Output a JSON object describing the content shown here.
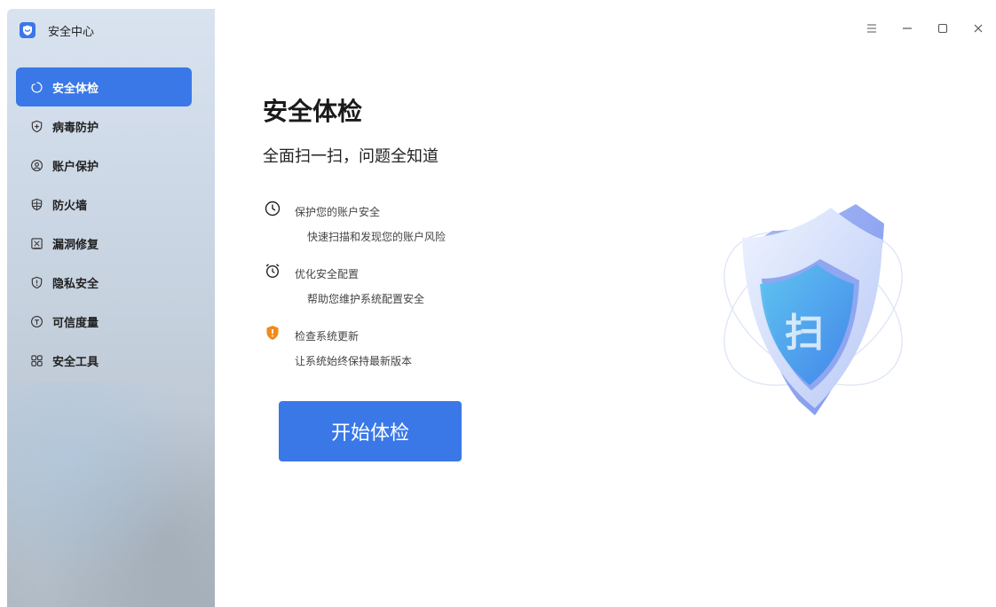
{
  "app": {
    "title": "安全中心"
  },
  "sidebar": {
    "items": [
      {
        "label": "安全体检",
        "icon": "scan-refresh-icon",
        "active": true
      },
      {
        "label": "病毒防护",
        "icon": "shield-plus-icon",
        "active": false
      },
      {
        "label": "账户保护",
        "icon": "user-circle-icon",
        "active": false
      },
      {
        "label": "防火墙",
        "icon": "firewall-icon",
        "active": false
      },
      {
        "label": "漏洞修复",
        "icon": "vulnerability-icon",
        "active": false
      },
      {
        "label": "隐私安全",
        "icon": "privacy-shield-icon",
        "active": false
      },
      {
        "label": "可信度量",
        "icon": "trust-shield-icon",
        "active": false
      },
      {
        "label": "安全工具",
        "icon": "tools-grid-icon",
        "active": false
      }
    ]
  },
  "window_controls": [
    "menu-icon",
    "minimize-icon",
    "maximize-icon",
    "close-icon"
  ],
  "main": {
    "title": "安全体检",
    "subtitle": "全面扫一扫，问题全知道",
    "features": [
      {
        "title": "保护您的账户安全",
        "desc": "快速扫描和发现您的账户风险",
        "icon": "clock-icon"
      },
      {
        "title": "优化安全配置",
        "desc": "帮助您维护系统配置安全",
        "icon": "alarm-clock-icon"
      },
      {
        "title": "检查系统更新",
        "desc": "让系统始终保持最新版本",
        "icon": "orange-shield-warning-icon"
      }
    ],
    "start_button": "开始体检",
    "illustration_text": "扫"
  },
  "colors": {
    "accent": "#3a78e8",
    "warning": "#f08a1c"
  }
}
